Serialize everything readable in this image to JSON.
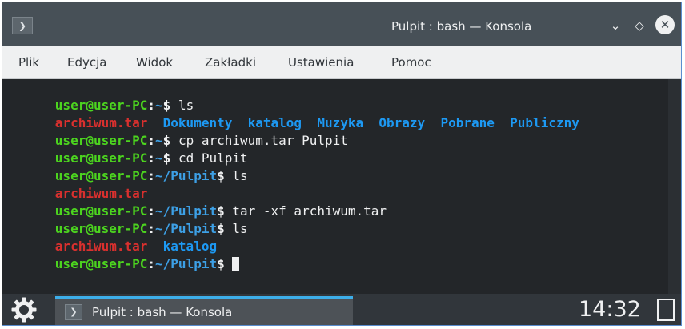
{
  "window": {
    "title": "Pulpit : bash — Konsola",
    "border_color": "#5a8ed0",
    "icons": {
      "app": "terminal-icon",
      "minimize": "chevron-down-icon",
      "maximize": "diamond-icon",
      "close": "close-icon"
    }
  },
  "menu": {
    "items": [
      "Plik",
      "Edycja",
      "Widok",
      "Zakładki",
      "Ustawienia",
      "Pomoc"
    ]
  },
  "terminal": {
    "colors": {
      "background": "#232629",
      "prompt_user": "#4cd41f",
      "prompt_dir": "#3da0e6",
      "archive": "#d9302e",
      "directory": "#1d99f3"
    },
    "lines": [
      {
        "prompt": {
          "user": "user@user-PC",
          "sep": ":",
          "dir": "~",
          "sym": "$"
        },
        "command": " ls"
      },
      {
        "files": [
          "archiwum.tar",
          "Dokumenty",
          "katalog",
          "Muzyka",
          "Obrazy",
          "Pobrane",
          "Publiczny"
        ]
      },
      {
        "prompt": {
          "user": "user@user-PC",
          "sep": ":",
          "dir": "~",
          "sym": "$"
        },
        "command": " cp archiwum.tar Pulpit"
      },
      {
        "prompt": {
          "user": "user@user-PC",
          "sep": ":",
          "dir": "~",
          "sym": "$"
        },
        "command": " cd Pulpit"
      },
      {
        "prompt": {
          "user": "user@user-PC",
          "sep": ":",
          "dir": "~/Pulpit",
          "sym": "$"
        },
        "command": " ls"
      },
      {
        "files": [
          "archiwum.tar"
        ]
      },
      {
        "prompt": {
          "user": "user@user-PC",
          "sep": ":",
          "dir": "~/Pulpit",
          "sym": "$"
        },
        "command": " tar -xf archiwum.tar"
      },
      {
        "prompt": {
          "user": "user@user-PC",
          "sep": ":",
          "dir": "~/Pulpit",
          "sym": "$"
        },
        "command": " ls"
      },
      {
        "files": [
          "archiwum.tar",
          "katalog"
        ]
      },
      {
        "prompt": {
          "user": "user@user-PC",
          "sep": ":",
          "dir": "~/Pulpit",
          "sym": "$"
        },
        "command": " "
      }
    ]
  },
  "taskbar": {
    "launcher_icon": "gear-icon",
    "task_label": "Pulpit : bash — Konsola",
    "task_icon": "terminal-icon",
    "clock": "14:32",
    "show_desktop_icon": "show-desktop-icon",
    "accent": "#3daee9"
  }
}
